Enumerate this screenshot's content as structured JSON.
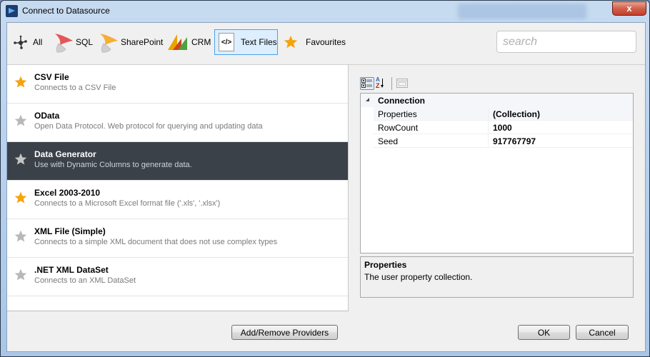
{
  "window": {
    "title": "Connect to Datasource",
    "close_label": "x"
  },
  "toolbar": {
    "categories": [
      {
        "label": "All",
        "icon": "network-nodes-icon",
        "active": false
      },
      {
        "label": "SQL",
        "icon": "sql-server-icon",
        "active": false
      },
      {
        "label": "SharePoint",
        "icon": "sharepoint-icon",
        "active": false
      },
      {
        "label": "CRM",
        "icon": "dynamics-crm-icon",
        "active": false
      },
      {
        "label": "Text Files",
        "icon": "code-file-icon",
        "active": true
      },
      {
        "label": "Favourites",
        "icon": "star-icon",
        "active": false
      }
    ],
    "code_glyph": "</>",
    "search": {
      "value": "",
      "placeholder": "search"
    }
  },
  "providers": [
    {
      "name": "CSV File",
      "description": "Connects to a CSV File",
      "favourite": true,
      "selected": false
    },
    {
      "name": "OData",
      "description": "Open Data Protocol. Web protocol for querying and updating data",
      "favourite": false,
      "selected": false
    },
    {
      "name": "Data Generator",
      "description": "Use with Dynamic Columns to generate data.",
      "favourite": false,
      "selected": true
    },
    {
      "name": "Excel 2003-2010",
      "description": "Connects to a Microsoft Excel format file ('.xls', '.xlsx')",
      "favourite": true,
      "selected": false
    },
    {
      "name": "XML File (Simple)",
      "description": "Connects to a simple XML document that does not use complex types",
      "favourite": false,
      "selected": false
    },
    {
      "name": ".NET XML DataSet",
      "description": "Connects to an XML DataSet",
      "favourite": false,
      "selected": false
    }
  ],
  "property_grid": {
    "toolbar": {
      "categorized": "categorized-view-icon",
      "alphabetical": "sort-alphabetical-icon",
      "property_pages": "property-pages-icon",
      "az_glyph_a": "A",
      "az_glyph_z": "Z"
    },
    "category": "Connection",
    "rows": [
      {
        "name": "Properties",
        "value": "(Collection)"
      },
      {
        "name": "RowCount",
        "value": "1000"
      },
      {
        "name": "Seed",
        "value": "917767797"
      }
    ],
    "help": {
      "title": "Properties",
      "description": "The user property collection."
    }
  },
  "footer": {
    "add_remove_label": "Add/Remove Providers",
    "ok_label": "OK",
    "cancel_label": "Cancel"
  },
  "colors": {
    "selected_row": "#3b4149",
    "favourite_star": "#f7a30b",
    "unfavourite_star": "#b8b8b8",
    "active_tab_border": "#4aa1e6"
  }
}
